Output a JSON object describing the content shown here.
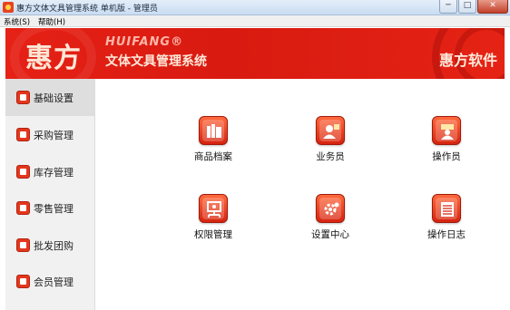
{
  "window": {
    "title": "惠方文体文具管理系统 单机版 - 管理员",
    "controls": {
      "minimize": "─",
      "maximize": "□",
      "close": "✕"
    }
  },
  "menu": [
    {
      "label": "系统(S)"
    },
    {
      "label": "帮助(H)"
    }
  ],
  "banner": {
    "logo_cn": "惠方",
    "logo_en": "HUIFANG®",
    "subtitle": "文体文具管理系统",
    "brand_right": "惠方软件",
    "color": "#e62116"
  },
  "sidebar": {
    "items": [
      {
        "label": "基础设置",
        "icon": "settings-icon",
        "active": true
      },
      {
        "label": "采购管理",
        "icon": "purchase-icon"
      },
      {
        "label": "库存管理",
        "icon": "inventory-icon"
      },
      {
        "label": "零售管理",
        "icon": "retail-icon"
      },
      {
        "label": "批发团购",
        "icon": "wholesale-icon"
      },
      {
        "label": "会员管理",
        "icon": "member-icon"
      }
    ]
  },
  "tiles": [
    {
      "label": "商品档案",
      "icon": "product-archive-icon"
    },
    {
      "label": "业务员",
      "icon": "salesperson-icon"
    },
    {
      "label": "操作员",
      "icon": "operator-icon"
    },
    {
      "label": "权限管理",
      "icon": "permission-icon"
    },
    {
      "label": "设置中心",
      "icon": "settings-center-icon"
    },
    {
      "label": "操作日志",
      "icon": "operation-log-icon"
    }
  ]
}
